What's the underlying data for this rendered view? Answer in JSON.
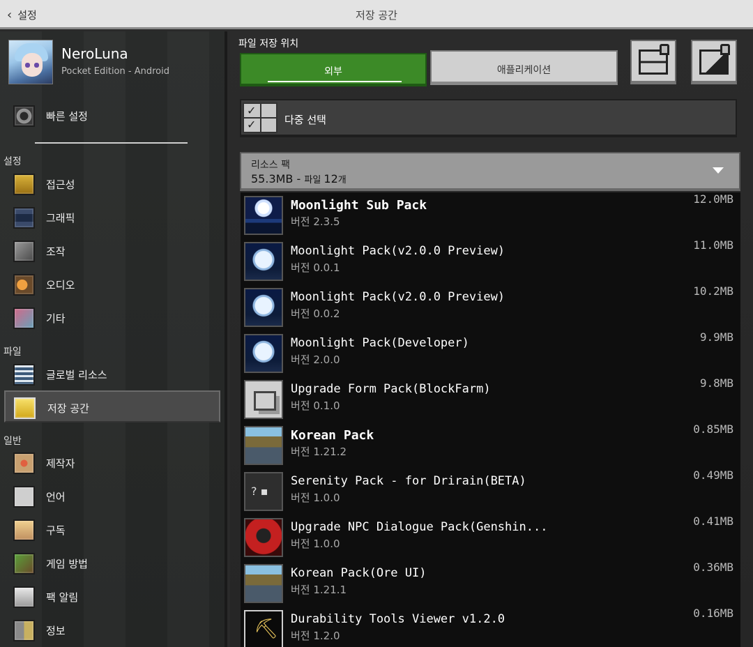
{
  "topbar": {
    "back_label": "설정",
    "title": "저장 공간"
  },
  "profile": {
    "name": "NeroLuna",
    "subtitle": "Pocket Edition - Android"
  },
  "sidebar": {
    "quick": {
      "label": "빠른 설정",
      "icon": "gear-icon"
    },
    "sections": {
      "settings": "설정",
      "file": "파일",
      "general": "일반"
    },
    "settings_items": [
      {
        "label": "접근성",
        "icon": "key-icon"
      },
      {
        "label": "그래픽",
        "icon": "monitor-icon"
      },
      {
        "label": "조작",
        "icon": "controller-icon"
      },
      {
        "label": "오디오",
        "icon": "speaker-icon"
      },
      {
        "label": "기타",
        "icon": "misc-icon"
      }
    ],
    "file_items": [
      {
        "label": "글로벌 리소스",
        "icon": "global-resources-icon"
      },
      {
        "label": "저장 공간",
        "icon": "folder-icon",
        "selected": true
      }
    ],
    "general_items": [
      {
        "label": "제작자",
        "icon": "creator-icon"
      },
      {
        "label": "언어",
        "icon": "language-icon"
      },
      {
        "label": "구독",
        "icon": "subscription-icon"
      },
      {
        "label": "게임 방법",
        "icon": "how-to-play-icon"
      },
      {
        "label": "팩 알림",
        "icon": "alert-icon"
      },
      {
        "label": "정보",
        "icon": "info-icon"
      }
    ]
  },
  "main": {
    "location_label": "파일 저장 위치",
    "tab_external": "외부",
    "tab_app": "애플리케이션",
    "multi_select": "다중 선택",
    "pack_header": {
      "title": "리소스 팩",
      "summary_size": "55.3MB",
      "summary_sep": " - ",
      "summary_files_label": "파일 ",
      "summary_files_count": "12",
      "summary_files_unit": "개"
    },
    "packs": [
      {
        "name": "Moonlight Sub Pack",
        "version": "버전 2.3.5",
        "size": "12.0MB",
        "bold": true,
        "thumb": "th-moon-sea"
      },
      {
        "name": "Moonlight Pack(v2.0.0 Preview)",
        "version": "버전 0.0.1",
        "size": "11.0MB",
        "bold": false,
        "thumb": "th-moon"
      },
      {
        "name": "Moonlight Pack(v2.0.0 Preview)",
        "version": "버전 0.0.2",
        "size": "10.2MB",
        "bold": false,
        "thumb": "th-moon"
      },
      {
        "name": "Moonlight Pack(Developer)",
        "version": "버전 2.0.0",
        "size": "9.9MB",
        "bold": false,
        "thumb": "th-moon"
      },
      {
        "name": "Upgrade Form Pack(BlockFarm)",
        "version": "버전 0.1.0",
        "size": "9.8MB",
        "bold": false,
        "thumb": "th-upgrade"
      },
      {
        "name": "Korean Pack",
        "version": "버전 1.21.2",
        "size": "0.85MB",
        "bold": true,
        "thumb": "th-korean"
      },
      {
        "name": "Serenity Pack - for Drirain(BETA)",
        "version": "버전 1.0.0",
        "size": "0.49MB",
        "bold": false,
        "thumb": "th-unknown"
      },
      {
        "name": "Upgrade NPC Dialogue Pack(Genshin...",
        "version": "버전 1.0.0",
        "size": "0.41MB",
        "bold": false,
        "thumb": "th-npc"
      },
      {
        "name": "Korean Pack(Ore UI)",
        "version": "버전 1.21.1",
        "size": "0.36MB",
        "bold": false,
        "thumb": "th-korean"
      },
      {
        "name": "Durability Tools Viewer v1.2.0",
        "version": "버전 1.2.0",
        "size": "0.16MB",
        "bold": false,
        "thumb": "th-tools"
      }
    ]
  }
}
